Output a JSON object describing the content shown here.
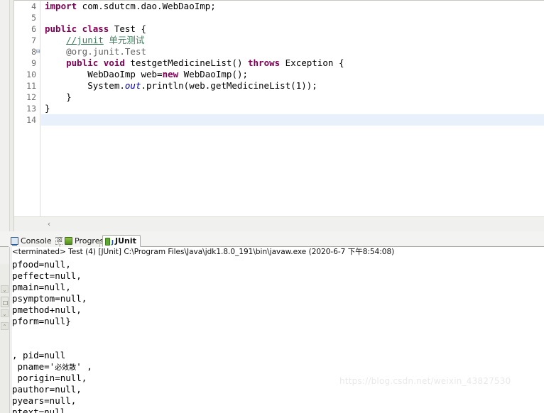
{
  "editor": {
    "lines": [
      {
        "num": "4",
        "fold": false,
        "current": false,
        "tokens": [
          {
            "t": "kw",
            "v": "import"
          },
          {
            "t": "plain",
            "v": " com.sdutcm.dao.WebDaoImp;"
          }
        ]
      },
      {
        "num": "5",
        "fold": false,
        "current": false,
        "tokens": []
      },
      {
        "num": "6",
        "fold": false,
        "current": false,
        "tokens": [
          {
            "t": "kw",
            "v": "public class"
          },
          {
            "t": "plain",
            "v": " Test {"
          }
        ]
      },
      {
        "num": "7",
        "fold": false,
        "current": false,
        "tokens": [
          {
            "t": "plain",
            "v": "    "
          },
          {
            "t": "cmt-u",
            "v": "//junit"
          },
          {
            "t": "cmt-cn",
            "v": " 单元测试"
          }
        ]
      },
      {
        "num": "8",
        "fold": true,
        "current": false,
        "tokens": [
          {
            "t": "plain",
            "v": "    "
          },
          {
            "t": "ann",
            "v": "@org.junit.Test"
          }
        ]
      },
      {
        "num": "9",
        "fold": false,
        "current": false,
        "tokens": [
          {
            "t": "plain",
            "v": "    "
          },
          {
            "t": "kw",
            "v": "public void"
          },
          {
            "t": "plain",
            "v": " testgetMedicineList() "
          },
          {
            "t": "kw",
            "v": "throws"
          },
          {
            "t": "plain",
            "v": " Exception {"
          }
        ]
      },
      {
        "num": "10",
        "fold": false,
        "current": false,
        "tokens": [
          {
            "t": "plain",
            "v": "        WebDaoImp web="
          },
          {
            "t": "kw",
            "v": "new"
          },
          {
            "t": "plain",
            "v": " WebDaoImp();"
          }
        ]
      },
      {
        "num": "11",
        "fold": false,
        "current": false,
        "tokens": [
          {
            "t": "plain",
            "v": "        System."
          },
          {
            "t": "fld",
            "v": "out"
          },
          {
            "t": "plain",
            "v": ".println(web.getMedicineList(1));"
          }
        ]
      },
      {
        "num": "12",
        "fold": false,
        "current": false,
        "tokens": [
          {
            "t": "plain",
            "v": "    }"
          }
        ]
      },
      {
        "num": "13",
        "fold": false,
        "current": false,
        "tokens": [
          {
            "t": "plain",
            "v": "}"
          }
        ]
      },
      {
        "num": "14",
        "fold": false,
        "current": true,
        "tokens": []
      }
    ],
    "hscroll_left_arrow": "‹"
  },
  "tabs": [
    {
      "label": "Console",
      "icon": "console-icon",
      "active": false,
      "closable": true,
      "close_glyph": "☒"
    },
    {
      "label": "Progress",
      "icon": "progress-icon",
      "active": false,
      "closable": false,
      "close_glyph": ""
    },
    {
      "label": "JUnit",
      "icon": "junit-icon",
      "active": true,
      "closable": false,
      "close_glyph": ""
    }
  ],
  "console": {
    "terminated_line": "<terminated> Test (4) [JUnit] C:\\Program Files\\Java\\jdk1.8.0_191\\bin\\javaw.exe (2020-6-7 下午8:54:08)",
    "output_lines": [
      "pfood=null,",
      "peffect=null,",
      "pmain=null,",
      "psymptom=null,",
      "pmethod+null,",
      "pform=null}",
      "",
      "",
      ", pid=null",
      " pname='必效散' ,",
      " porigin=null,",
      "pauthor=null,",
      "pyears=null,",
      "ptext=null,"
    ],
    "scrollbar": {
      "down_arrow": "⌄",
      "collapse_arrow": "⌄",
      "up_arrow": "⌃"
    }
  },
  "watermark": {
    "text": "https://blog.csdn.net/weixin_43827530"
  },
  "colors": {
    "keyword": "#7f0055",
    "comment": "#3f7f5f",
    "field": "#0000c0",
    "annotation": "#646464",
    "current_line": "#e8f0fc",
    "editor_bg": "#ffffff",
    "chrome_bg": "#f3f3f1"
  }
}
